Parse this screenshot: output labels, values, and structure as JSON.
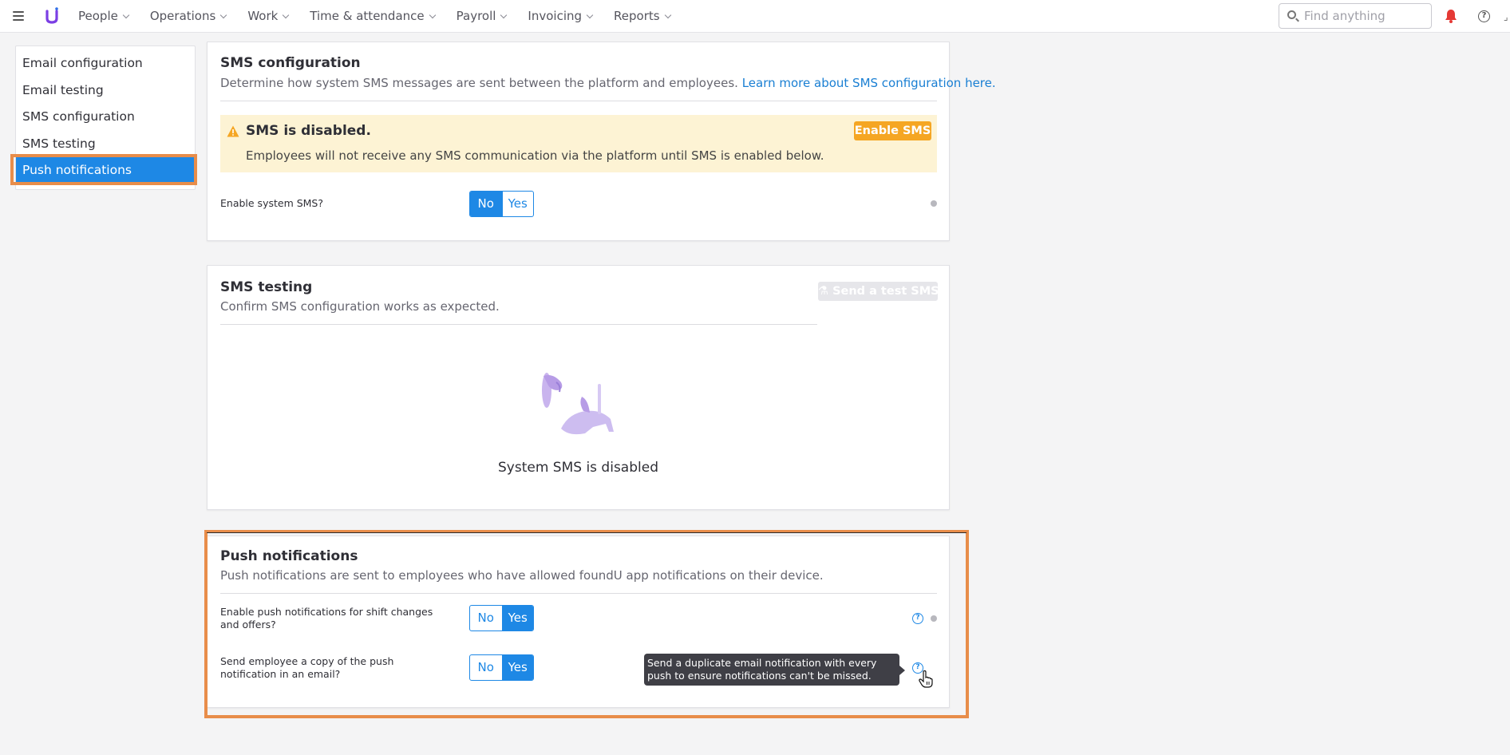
{
  "topbar": {
    "nav": [
      "People",
      "Operations",
      "Work",
      "Time & attendance",
      "Payroll",
      "Invoicing",
      "Reports"
    ],
    "search_placeholder": "Find anything",
    "help_glyph": "?",
    "corner_glyph": "⌟"
  },
  "sidebar": {
    "items": [
      "Email configuration",
      "Email testing",
      "SMS configuration",
      "SMS testing",
      "Push notifications"
    ],
    "active_index": 4
  },
  "sms_config": {
    "title": "SMS configuration",
    "description": "Determine how system SMS messages are sent between the platform and employees.",
    "link": "Learn more about SMS configuration here.",
    "alert_title": "SMS is disabled.",
    "alert_body": "Employees will not receive any SMS communication via the platform until SMS is enabled below.",
    "alert_button": "Enable SMS",
    "field_label": "Enable system SMS?",
    "toggle": {
      "no": "No",
      "yes": "Yes",
      "selected": "No"
    }
  },
  "sms_testing": {
    "title": "SMS testing",
    "description": "Confirm SMS configuration works as expected.",
    "button": "Send a test SMS",
    "empty_text": "System SMS is disabled"
  },
  "push": {
    "title": "Push notifications",
    "description": "Push notifications are sent to employees who have allowed foundU app notifications on their device.",
    "field1_label": "Enable push notifications for shift changes and offers?",
    "field1_toggle": {
      "no": "No",
      "yes": "Yes",
      "selected": "Yes"
    },
    "field2_label": "Send employee a copy of the push notification in an email?",
    "field2_toggle": {
      "no": "No",
      "yes": "Yes",
      "selected": "Yes"
    },
    "help_glyph": "?",
    "tooltip": "Send a duplicate email notification with every push to ensure notifications can't be missed."
  },
  "colors": {
    "accent": "#1e88e5",
    "warning": "#f5a623",
    "highlight": "#e88d4a",
    "notification": "#e53935"
  }
}
